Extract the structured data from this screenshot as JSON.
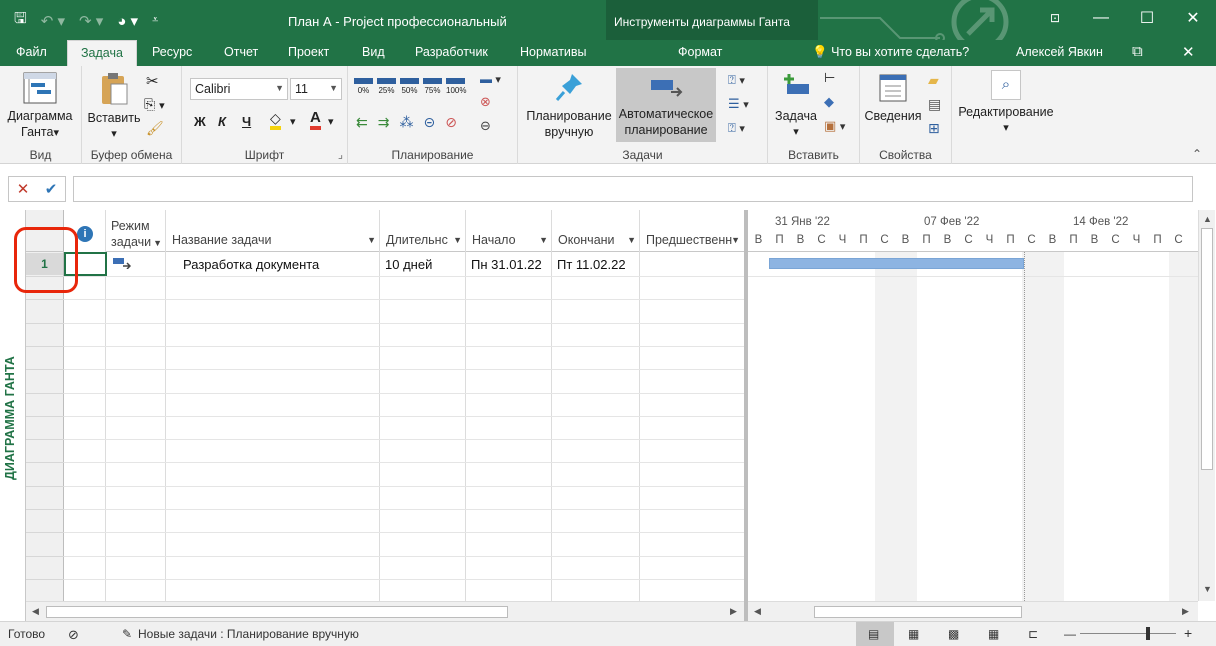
{
  "window": {
    "title": "План А - Project профессиональный",
    "context_group": "Инструменты диаграммы Ганта",
    "minimize": "—",
    "restore": "☐",
    "close": "✕"
  },
  "tabs": {
    "file": "Файл",
    "task": "Задача",
    "resource": "Ресурс",
    "report": "Отчет",
    "project": "Проект",
    "view": "Вид",
    "developer": "Разработчик",
    "norms": "Нормативы",
    "format": "Формат",
    "help": "Что вы хотите сделать?",
    "user": "Алексей Явкин"
  },
  "ribbon": {
    "view_group": {
      "gantt_label1": "Диаграмма",
      "gantt_label2": "Ганта",
      "name": "Вид"
    },
    "clipboard_group": {
      "paste_label": "Вставить",
      "name": "Буфер обмена"
    },
    "font_group": {
      "font_name": "Calibri",
      "font_size": "11",
      "bold": "Ж",
      "italic": "К",
      "underline": "Ч",
      "name": "Шрифт"
    },
    "schedule_group": {
      "pct0": "0%",
      "pct25": "25%",
      "pct50": "50%",
      "pct75": "75%",
      "pct100": "100%",
      "name": "Планирование"
    },
    "tasks_group": {
      "manual1": "Планирование",
      "manual2": "вручную",
      "auto1": "Автоматическое",
      "auto2": "планирование",
      "name": "Задачи"
    },
    "insert_group": {
      "task_label": "Задача",
      "name": "Вставить"
    },
    "properties_group": {
      "info_label": "Сведения",
      "name": "Свойства"
    },
    "editing_group": {
      "label": "Редактирование"
    }
  },
  "sidebar": {
    "view_label": "ДИАГРАММА ГАНТА"
  },
  "table": {
    "columns": [
      "",
      "Режим задачи",
      "Название задачи",
      "Длительнс",
      "Начало",
      "Окончани",
      "Предшественн"
    ],
    "rows": [
      {
        "id": "1",
        "name": "Разработка документа",
        "duration": "10 дней",
        "start": "Пн 31.01.22",
        "finish": "Пт 11.02.22",
        "predecessors": ""
      }
    ]
  },
  "gantt": {
    "weeks": [
      "31 Янв '22",
      "07 Фев '22",
      "14 Фев '22"
    ],
    "days": [
      "В",
      "П",
      "В",
      "С",
      "Ч",
      "П",
      "С",
      "В",
      "П",
      "В",
      "С",
      "Ч",
      "П",
      "С",
      "В",
      "П",
      "В",
      "С",
      "Ч",
      "П",
      "С"
    ]
  },
  "status": {
    "ready": "Готово",
    "new_tasks": "Новые задачи : Планирование вручную"
  },
  "colors": {
    "accent": "#217346",
    "bar": "#8db4e2",
    "highlight": "#e8260a"
  }
}
